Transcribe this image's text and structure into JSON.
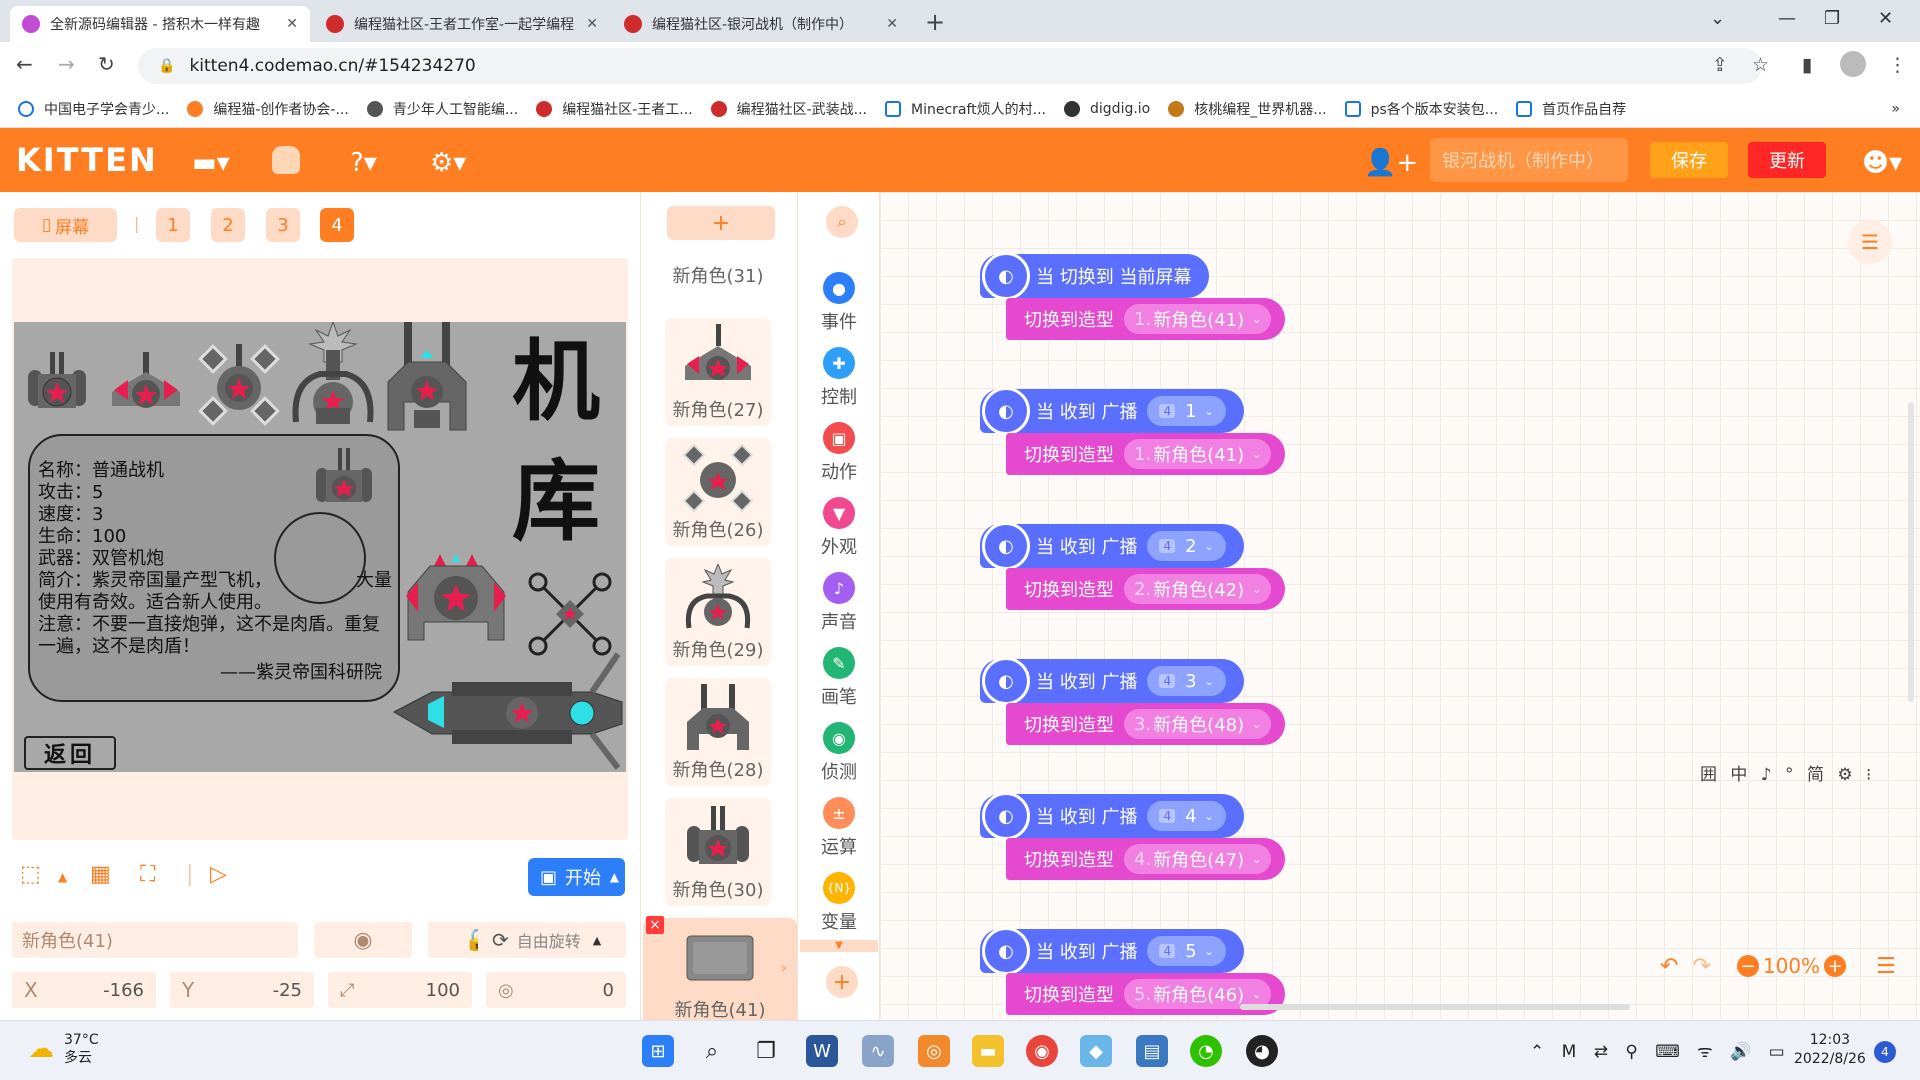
{
  "browser": {
    "tabs": [
      {
        "title": "全新源码编辑器 - 搭积木一样有趣",
        "fav_color": "#c44bd6"
      },
      {
        "title": "编程猫社区-王者工作室-一起学编程",
        "fav_color": "#d02b2b"
      },
      {
        "title": "编程猫社区-银河战机（制作中）",
        "fav_color": "#d02b2b"
      }
    ],
    "new_tab": "+",
    "url": "kitten4.codemao.cn/#154234270",
    "bookmarks": [
      {
        "label": "中国电子学会青少...",
        "color": "#1a73e8"
      },
      {
        "label": "编程猫-创作者协会-...",
        "color": "#ff7e21"
      },
      {
        "label": "青少年人工智能编...",
        "color": "#555555"
      },
      {
        "label": "编程猫社区-王者工...",
        "color": "#d02b2b"
      },
      {
        "label": "编程猫社区-武装战...",
        "color": "#d02b2b"
      },
      {
        "label": "Minecraft烦人的村...",
        "color": "#1a73e8"
      },
      {
        "label": "digdig.io",
        "color": "#333333"
      },
      {
        "label": "核桃编程_世界机器...",
        "color": "#c47a1b"
      },
      {
        "label": "ps各个版本安装包...",
        "color": "#1a73e8"
      },
      {
        "label": "首页作品自荐",
        "color": "#1a73e8"
      }
    ],
    "more_bookmarks": "»"
  },
  "app": {
    "logo": "KITTEN",
    "project_name": "银河战机（制作中）",
    "save_label": "保存",
    "update_label": "更新"
  },
  "stage_panel": {
    "screen_label": "屏幕",
    "separator": "|",
    "screens": [
      "1",
      "2",
      "3",
      "4"
    ],
    "active_screen": "4",
    "stage": {
      "hangar_title": [
        "机",
        "库"
      ],
      "info_lines": [
        "名称：普通战机",
        "攻击：5",
        "速度：3",
        "生命：100",
        "武器：双管机炮",
        "简介：紫灵帝国量产型飞机，",
        "大量",
        "使用有奇效。适合新人使用。",
        "注意：不要一直接炮弹，这不是肉盾。重复",
        "一遍，这不是肉盾！",
        "——紫灵帝国科研院"
      ],
      "back_label": "返回"
    },
    "start_label": "开始",
    "sprite_name": "新角色(41)",
    "rotation_label": "自由旋转",
    "x_label": "X",
    "x_value": "-166",
    "y_label": "Y",
    "y_value": "-25",
    "size_value": "100",
    "direction_value": "0"
  },
  "sprites": {
    "add_label": "+",
    "items": [
      "新角色(31)",
      "新角色(27)",
      "新角色(26)",
      "新角色(29)",
      "新角色(28)",
      "新角色(30)",
      "新角色(41)"
    ],
    "selected": "新角色(41)",
    "delete_label": "×"
  },
  "categories": [
    {
      "label": "事件",
      "color": "#2d7ff9"
    },
    {
      "label": "控制",
      "color": "#2d9ff9"
    },
    {
      "label": "动作",
      "color": "#f24c4c"
    },
    {
      "label": "外观",
      "color": "#f2488f"
    },
    {
      "label": "声音",
      "color": "#a45ef2"
    },
    {
      "label": "画笔",
      "color": "#22b573"
    },
    {
      "label": "侦测",
      "color": "#22b573"
    },
    {
      "label": "运算",
      "color": "#ff8d5a"
    },
    {
      "label": "变量",
      "color": "#ffb400"
    }
  ],
  "blocks": [
    {
      "hat": "当 切换到 当前屏幕",
      "hat_value": "",
      "stmt": "切换到造型",
      "costume_num": "1.",
      "costume": "新角色(41)"
    },
    {
      "hat": "当 收到 广播",
      "hat_value": "1",
      "stmt": "切换到造型",
      "costume_num": "1.",
      "costume": "新角色(41)"
    },
    {
      "hat": "当 收到 广播",
      "hat_value": "2",
      "stmt": "切换到造型",
      "costume_num": "2.",
      "costume": "新角色(42)"
    },
    {
      "hat": "当 收到 广播",
      "hat_value": "3",
      "stmt": "切换到造型",
      "costume_num": "3.",
      "costume": "新角色(48)"
    },
    {
      "hat": "当 收到 广播",
      "hat_value": "4",
      "stmt": "切换到造型",
      "costume_num": "4.",
      "costume": "新角色(47)"
    },
    {
      "hat": "当 收到 广播",
      "hat_value": "5",
      "stmt": "切换到造型",
      "costume_num": "5.",
      "costume": "新角色(46)"
    }
  ],
  "broadcast_tag": "4",
  "workspace": {
    "zoom": "100%",
    "ime_bar": "囲 中 ♪ ° 简 ⚙ ⁝"
  },
  "taskbar": {
    "temperature": "37°C",
    "weather": "多云",
    "time": "12:03",
    "date": "2022/8/26",
    "notifications": "4"
  }
}
